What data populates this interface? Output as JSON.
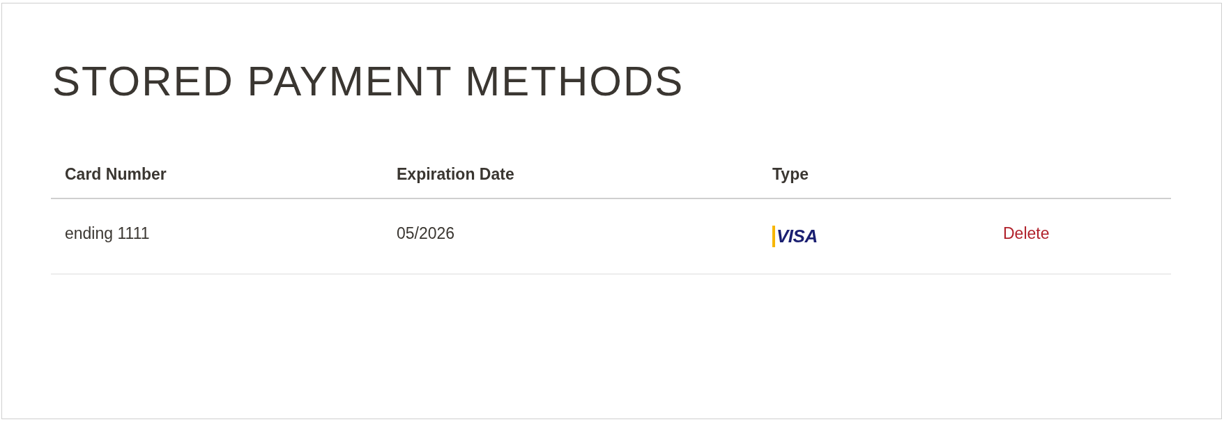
{
  "title": "STORED PAYMENT METHODS",
  "table": {
    "columns": [
      "Card Number",
      "Expiration Date",
      "Type"
    ],
    "rows": [
      {
        "card_number": "ending 1111",
        "expiration_date": "05/2026",
        "type": "VISA",
        "action": "Delete"
      }
    ]
  }
}
